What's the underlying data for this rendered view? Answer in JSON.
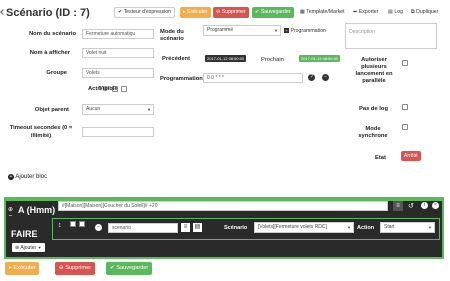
{
  "header": {
    "title": "Scénario (ID : 7)",
    "buttons": {
      "test": "Testeur d'expression",
      "execute": "Exécuter",
      "delete": "Supprimer",
      "save": "Sauvegarder",
      "template": "Template/Market",
      "export": "Exporter",
      "log": "Log",
      "duplicate": "Dupliquer"
    }
  },
  "form": {
    "name_label": "Nom du scénario",
    "name_value": "Fermeture automatiqu",
    "display_label": "Nom à afficher",
    "display_value": "Volet nuit",
    "group_label": "Groupe",
    "group_value": "Volets",
    "active_label": "Actif @",
    "visible_label": "Visible",
    "parent_label": "Objet parent",
    "parent_value": "Aucun",
    "timeout_label": "Timeout secondes (0 = illimité)",
    "timeout_value": ""
  },
  "mode": {
    "mode_label": "Mode du scénario",
    "mode_value": "Programmé",
    "programmation_btn": "Programmation",
    "description_placeholder": "Description",
    "prev_label": "Précédent",
    "prev_value": "2017-01-12 08:50:00",
    "next_label": "Prochain",
    "next_value": "2017-01-13 08:50:00",
    "prog_label": "Programmation",
    "prog_value": "0 0 * * *",
    "allow_multi_label": "Autoriser plusieurs lancement en parallèle",
    "no_log_label": "Pas de log",
    "sync_label": "Mode synchrone",
    "state_label": "Etat",
    "state_value": "Arrêté"
  },
  "add_block": "Ajouter bloc",
  "block": {
    "at_label": "A (Hmm)",
    "expression": "#[Maison][Maison][Coucher du Soleil]# +20",
    "faire": "FAIRE",
    "ajouter": "Ajouter",
    "scenario_input": "scenario",
    "scenario_label": "Scénario",
    "scenario_value": "[Volets][Fermeture volets RDC]",
    "action_label": "Action",
    "action_value": "Start"
  },
  "footer": {
    "execute": "Exécuter",
    "delete": "Supprimer",
    "save": "Sauvegarder"
  },
  "colors": {
    "green": "#5cb85c",
    "orange": "#f0ad4e",
    "red": "#d9534f",
    "dark": "#3a3a3a",
    "block_bg": "#2a2a2a",
    "block_border": "#5cb85c",
    "faire_bg": "#29a329"
  }
}
